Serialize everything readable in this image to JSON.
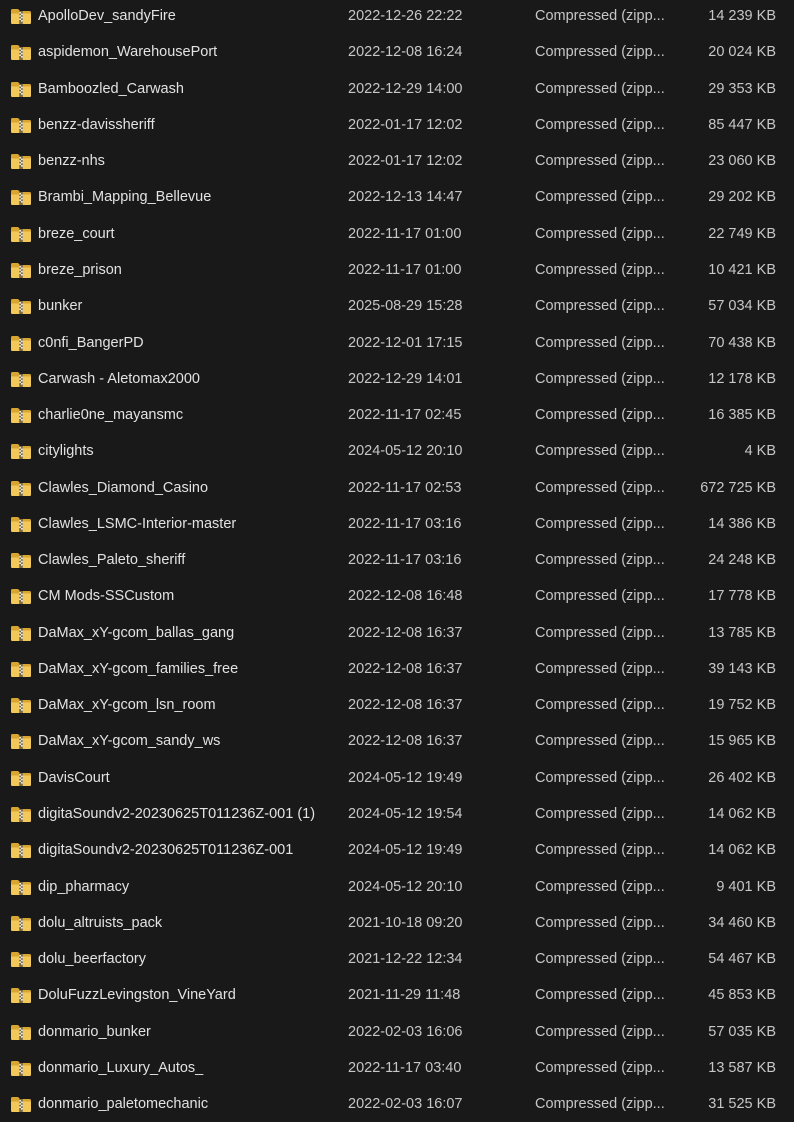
{
  "icons": {
    "row_icon": "zip-folder-icon"
  },
  "files": [
    {
      "name": "ApolloDev_sandyFire",
      "date": "2022-12-26 22:22",
      "type": "Compressed (zipp...",
      "size": "14 239 KB"
    },
    {
      "name": "aspidemon_WarehousePort",
      "date": "2022-12-08 16:24",
      "type": "Compressed (zipp...",
      "size": "20 024 KB"
    },
    {
      "name": "Bamboozled_Carwash",
      "date": "2022-12-29 14:00",
      "type": "Compressed (zipp...",
      "size": "29 353 KB"
    },
    {
      "name": "benzz-davissheriff",
      "date": "2022-01-17 12:02",
      "type": "Compressed (zipp...",
      "size": "85 447 KB"
    },
    {
      "name": "benzz-nhs",
      "date": "2022-01-17 12:02",
      "type": "Compressed (zipp...",
      "size": "23 060 KB"
    },
    {
      "name": "Brambi_Mapping_Bellevue",
      "date": "2022-12-13 14:47",
      "type": "Compressed (zipp...",
      "size": "29 202 KB"
    },
    {
      "name": "breze_court",
      "date": "2022-11-17 01:00",
      "type": "Compressed (zipp...",
      "size": "22 749 KB"
    },
    {
      "name": "breze_prison",
      "date": "2022-11-17 01:00",
      "type": "Compressed (zipp...",
      "size": "10 421 KB"
    },
    {
      "name": "bunker",
      "date": "2025-08-29 15:28",
      "type": "Compressed (zipp...",
      "size": "57 034 KB"
    },
    {
      "name": "c0nfi_BangerPD",
      "date": "2022-12-01 17:15",
      "type": "Compressed (zipp...",
      "size": "70 438 KB"
    },
    {
      "name": "Carwash - Aletomax2000",
      "date": "2022-12-29 14:01",
      "type": "Compressed (zipp...",
      "size": "12 178 KB"
    },
    {
      "name": "charlie0ne_mayansmc",
      "date": "2022-11-17 02:45",
      "type": "Compressed (zipp...",
      "size": "16 385 KB"
    },
    {
      "name": "citylights",
      "date": "2024-05-12 20:10",
      "type": "Compressed (zipp...",
      "size": "4 KB"
    },
    {
      "name": "Clawles_Diamond_Casino",
      "date": "2022-11-17 02:53",
      "type": "Compressed (zipp...",
      "size": "672 725 KB"
    },
    {
      "name": "Clawles_LSMC-Interior-master",
      "date": "2022-11-17 03:16",
      "type": "Compressed (zipp...",
      "size": "14 386 KB"
    },
    {
      "name": "Clawles_Paleto_sheriff",
      "date": "2022-11-17 03:16",
      "type": "Compressed (zipp...",
      "size": "24 248 KB"
    },
    {
      "name": "CM Mods-SSCustom",
      "date": "2022-12-08 16:48",
      "type": "Compressed (zipp...",
      "size": "17 778 KB"
    },
    {
      "name": "DaMax_xY-gcom_ballas_gang",
      "date": "2022-12-08 16:37",
      "type": "Compressed (zipp...",
      "size": "13 785 KB"
    },
    {
      "name": "DaMax_xY-gcom_families_free",
      "date": "2022-12-08 16:37",
      "type": "Compressed (zipp...",
      "size": "39 143 KB"
    },
    {
      "name": "DaMax_xY-gcom_lsn_room",
      "date": "2022-12-08 16:37",
      "type": "Compressed (zipp...",
      "size": "19 752 KB"
    },
    {
      "name": "DaMax_xY-gcom_sandy_ws",
      "date": "2022-12-08 16:37",
      "type": "Compressed (zipp...",
      "size": "15 965 KB"
    },
    {
      "name": "DavisCourt",
      "date": "2024-05-12 19:49",
      "type": "Compressed (zipp...",
      "size": "26 402 KB"
    },
    {
      "name": "digitaSoundv2-20230625T011236Z-001 (1)",
      "date": "2024-05-12 19:54",
      "type": "Compressed (zipp...",
      "size": "14 062 KB"
    },
    {
      "name": "digitaSoundv2-20230625T011236Z-001",
      "date": "2024-05-12 19:49",
      "type": "Compressed (zipp...",
      "size": "14 062 KB"
    },
    {
      "name": "dip_pharmacy",
      "date": "2024-05-12 20:10",
      "type": "Compressed (zipp...",
      "size": "9 401 KB"
    },
    {
      "name": "dolu_altruists_pack",
      "date": "2021-10-18 09:20",
      "type": "Compressed (zipp...",
      "size": "34 460 KB"
    },
    {
      "name": "dolu_beerfactory",
      "date": "2021-12-22 12:34",
      "type": "Compressed (zipp...",
      "size": "54 467 KB"
    },
    {
      "name": "DoluFuzzLevingston_VineYard",
      "date": "2021-11-29 11:48",
      "type": "Compressed (zipp...",
      "size": "45 853 KB"
    },
    {
      "name": "donmario_bunker",
      "date": "2022-02-03 16:06",
      "type": "Compressed (zipp...",
      "size": "57 035 KB"
    },
    {
      "name": "donmario_Luxury_Autos_",
      "date": "2022-11-17 03:40",
      "type": "Compressed (zipp...",
      "size": "13 587 KB"
    },
    {
      "name": "donmario_paletomechanic",
      "date": "2022-02-03 16:07",
      "type": "Compressed (zipp...",
      "size": "31 525 KB"
    }
  ]
}
